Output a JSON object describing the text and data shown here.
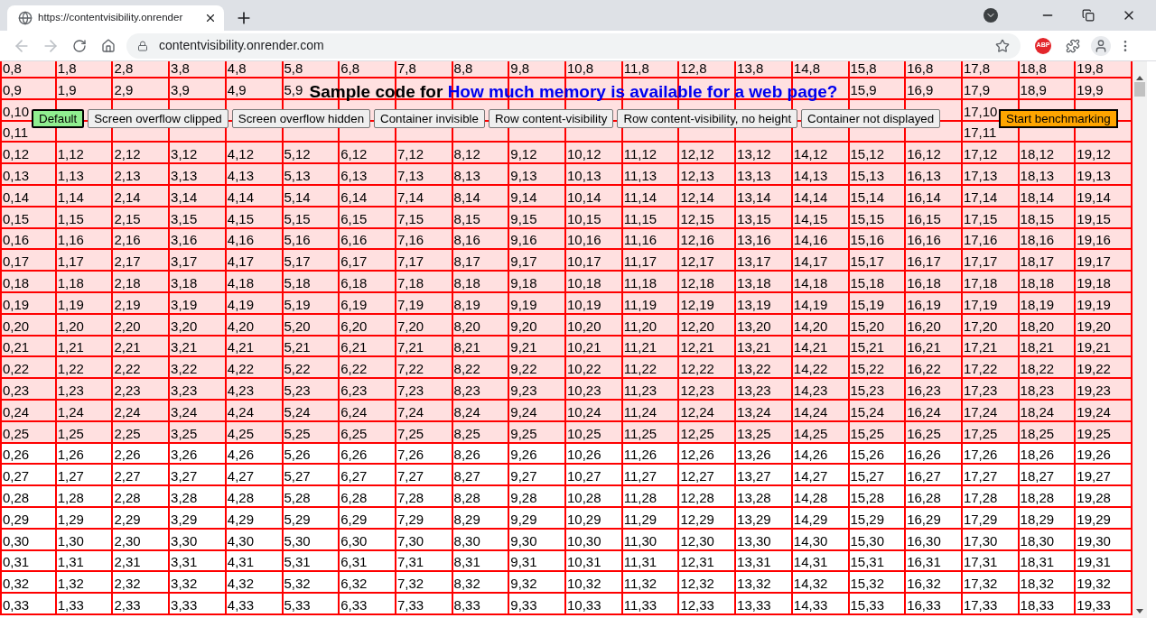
{
  "browser": {
    "tab_title": "https://contentvisibility.onrender",
    "address": "contentvisibility.onrender.com",
    "extension_badge": "ABP"
  },
  "page": {
    "heading": "Sample code for",
    "heading_link": "How much memory is available for a web page?",
    "buttons": [
      {
        "label": "Default",
        "selected": true
      },
      {
        "label": "Screen overflow clipped",
        "selected": false
      },
      {
        "label": "Screen overflow hidden",
        "selected": false
      },
      {
        "label": "Container invisible",
        "selected": false
      },
      {
        "label": "Row content-visibility",
        "selected": false
      },
      {
        "label": "Row content-visibility, no height",
        "selected": false
      },
      {
        "label": "Container not displayed",
        "selected": false
      }
    ],
    "benchmark_button": "Start benchmarking"
  },
  "table": {
    "rows": [
      {
        "shaded": true,
        "cells": [
          "0,8",
          "1,8",
          "2,8",
          "3,8",
          "4,8",
          "5,8",
          "6,8",
          "7,8",
          "8,8",
          "9,8",
          "10,8",
          "11,8",
          "12,8",
          "13,8",
          "14,8",
          "15,8",
          "16,8",
          "17,8",
          "18,8",
          "19,8"
        ]
      },
      {
        "shaded": true,
        "cells": [
          "0,9",
          "1,9",
          "2,9",
          "3,9",
          "4,9",
          "5,9",
          null,
          null,
          null,
          null,
          null,
          null,
          null,
          null,
          null,
          "15,9",
          "16,9",
          "17,9",
          "18,9",
          "19,9"
        ]
      },
      {
        "shaded": true,
        "cells": [
          "0,10",
          null,
          null,
          null,
          null,
          null,
          null,
          null,
          null,
          null,
          null,
          null,
          null,
          null,
          null,
          null,
          null,
          "17,10",
          null,
          null
        ]
      },
      {
        "shaded": true,
        "cells": [
          "0,11",
          null,
          null,
          null,
          null,
          null,
          null,
          null,
          null,
          null,
          null,
          null,
          null,
          null,
          null,
          null,
          null,
          "17,11",
          null,
          null
        ]
      },
      {
        "shaded": true,
        "cells": [
          "0,12",
          "1,12",
          "2,12",
          "3,12",
          "4,12",
          "5,12",
          "6,12",
          "7,12",
          "8,12",
          "9,12",
          "10,12",
          "11,12",
          "12,12",
          "13,12",
          "14,12",
          "15,12",
          "16,12",
          "17,12",
          "18,12",
          "19,12"
        ]
      },
      {
        "shaded": true,
        "cells": [
          "0,13",
          "1,13",
          "2,13",
          "3,13",
          "4,13",
          "5,13",
          "6,13",
          "7,13",
          "8,13",
          "9,13",
          "10,13",
          "11,13",
          "12,13",
          "13,13",
          "14,13",
          "15,13",
          "16,13",
          "17,13",
          "18,13",
          "19,13"
        ]
      },
      {
        "shaded": true,
        "cells": [
          "0,14",
          "1,14",
          "2,14",
          "3,14",
          "4,14",
          "5,14",
          "6,14",
          "7,14",
          "8,14",
          "9,14",
          "10,14",
          "11,14",
          "12,14",
          "13,14",
          "14,14",
          "15,14",
          "16,14",
          "17,14",
          "18,14",
          "19,14"
        ]
      },
      {
        "shaded": true,
        "cells": [
          "0,15",
          "1,15",
          "2,15",
          "3,15",
          "4,15",
          "5,15",
          "6,15",
          "7,15",
          "8,15",
          "9,15",
          "10,15",
          "11,15",
          "12,15",
          "13,15",
          "14,15",
          "15,15",
          "16,15",
          "17,15",
          "18,15",
          "19,15"
        ]
      },
      {
        "shaded": true,
        "cells": [
          "0,16",
          "1,16",
          "2,16",
          "3,16",
          "4,16",
          "5,16",
          "6,16",
          "7,16",
          "8,16",
          "9,16",
          "10,16",
          "11,16",
          "12,16",
          "13,16",
          "14,16",
          "15,16",
          "16,16",
          "17,16",
          "18,16",
          "19,16"
        ]
      },
      {
        "shaded": true,
        "cells": [
          "0,17",
          "1,17",
          "2,17",
          "3,17",
          "4,17",
          "5,17",
          "6,17",
          "7,17",
          "8,17",
          "9,17",
          "10,17",
          "11,17",
          "12,17",
          "13,17",
          "14,17",
          "15,17",
          "16,17",
          "17,17",
          "18,17",
          "19,17"
        ]
      },
      {
        "shaded": true,
        "cells": [
          "0,18",
          "1,18",
          "2,18",
          "3,18",
          "4,18",
          "5,18",
          "6,18",
          "7,18",
          "8,18",
          "9,18",
          "10,18",
          "11,18",
          "12,18",
          "13,18",
          "14,18",
          "15,18",
          "16,18",
          "17,18",
          "18,18",
          "19,18"
        ]
      },
      {
        "shaded": true,
        "cells": [
          "0,19",
          "1,19",
          "2,19",
          "3,19",
          "4,19",
          "5,19",
          "6,19",
          "7,19",
          "8,19",
          "9,19",
          "10,19",
          "11,19",
          "12,19",
          "13,19",
          "14,19",
          "15,19",
          "16,19",
          "17,19",
          "18,19",
          "19,19"
        ]
      },
      {
        "shaded": true,
        "cells": [
          "0,20",
          "1,20",
          "2,20",
          "3,20",
          "4,20",
          "5,20",
          "6,20",
          "7,20",
          "8,20",
          "9,20",
          "10,20",
          "11,20",
          "12,20",
          "13,20",
          "14,20",
          "15,20",
          "16,20",
          "17,20",
          "18,20",
          "19,20"
        ]
      },
      {
        "shaded": true,
        "cells": [
          "0,21",
          "1,21",
          "2,21",
          "3,21",
          "4,21",
          "5,21",
          "6,21",
          "7,21",
          "8,21",
          "9,21",
          "10,21",
          "11,21",
          "12,21",
          "13,21",
          "14,21",
          "15,21",
          "16,21",
          "17,21",
          "18,21",
          "19,21"
        ]
      },
      {
        "shaded": true,
        "cells": [
          "0,22",
          "1,22",
          "2,22",
          "3,22",
          "4,22",
          "5,22",
          "6,22",
          "7,22",
          "8,22",
          "9,22",
          "10,22",
          "11,22",
          "12,22",
          "13,22",
          "14,22",
          "15,22",
          "16,22",
          "17,22",
          "18,22",
          "19,22"
        ]
      },
      {
        "shaded": true,
        "cells": [
          "0,23",
          "1,23",
          "2,23",
          "3,23",
          "4,23",
          "5,23",
          "6,23",
          "7,23",
          "8,23",
          "9,23",
          "10,23",
          "11,23",
          "12,23",
          "13,23",
          "14,23",
          "15,23",
          "16,23",
          "17,23",
          "18,23",
          "19,23"
        ]
      },
      {
        "shaded": true,
        "cells": [
          "0,24",
          "1,24",
          "2,24",
          "3,24",
          "4,24",
          "5,24",
          "6,24",
          "7,24",
          "8,24",
          "9,24",
          "10,24",
          "11,24",
          "12,24",
          "13,24",
          "14,24",
          "15,24",
          "16,24",
          "17,24",
          "18,24",
          "19,24"
        ]
      },
      {
        "shaded": true,
        "cells": [
          "0,25",
          "1,25",
          "2,25",
          "3,25",
          "4,25",
          "5,25",
          "6,25",
          "7,25",
          "8,25",
          "9,25",
          "10,25",
          "11,25",
          "12,25",
          "13,25",
          "14,25",
          "15,25",
          "16,25",
          "17,25",
          "18,25",
          "19,25"
        ]
      },
      {
        "shaded": false,
        "cells": [
          "0,26",
          "1,26",
          "2,26",
          "3,26",
          "4,26",
          "5,26",
          "6,26",
          "7,26",
          "8,26",
          "9,26",
          "10,26",
          "11,26",
          "12,26",
          "13,26",
          "14,26",
          "15,26",
          "16,26",
          "17,26",
          "18,26",
          "19,26"
        ]
      },
      {
        "shaded": false,
        "cells": [
          "0,27",
          "1,27",
          "2,27",
          "3,27",
          "4,27",
          "5,27",
          "6,27",
          "7,27",
          "8,27",
          "9,27",
          "10,27",
          "11,27",
          "12,27",
          "13,27",
          "14,27",
          "15,27",
          "16,27",
          "17,27",
          "18,27",
          "19,27"
        ]
      },
      {
        "shaded": false,
        "cells": [
          "0,28",
          "1,28",
          "2,28",
          "3,28",
          "4,28",
          "5,28",
          "6,28",
          "7,28",
          "8,28",
          "9,28",
          "10,28",
          "11,28",
          "12,28",
          "13,28",
          "14,28",
          "15,28",
          "16,28",
          "17,28",
          "18,28",
          "19,28"
        ]
      },
      {
        "shaded": false,
        "cells": [
          "0,29",
          "1,29",
          "2,29",
          "3,29",
          "4,29",
          "5,29",
          "6,29",
          "7,29",
          "8,29",
          "9,29",
          "10,29",
          "11,29",
          "12,29",
          "13,29",
          "14,29",
          "15,29",
          "16,29",
          "17,29",
          "18,29",
          "19,29"
        ]
      },
      {
        "shaded": false,
        "cells": [
          "0,30",
          "1,30",
          "2,30",
          "3,30",
          "4,30",
          "5,30",
          "6,30",
          "7,30",
          "8,30",
          "9,30",
          "10,30",
          "11,30",
          "12,30",
          "13,30",
          "14,30",
          "15,30",
          "16,30",
          "17,30",
          "18,30",
          "19,30"
        ]
      },
      {
        "shaded": false,
        "cells": [
          "0,31",
          "1,31",
          "2,31",
          "3,31",
          "4,31",
          "5,31",
          "6,31",
          "7,31",
          "8,31",
          "9,31",
          "10,31",
          "11,31",
          "12,31",
          "13,31",
          "14,31",
          "15,31",
          "16,31",
          "17,31",
          "18,31",
          "19,31"
        ]
      },
      {
        "shaded": false,
        "cells": [
          "0,32",
          "1,32",
          "2,32",
          "3,32",
          "4,32",
          "5,32",
          "6,32",
          "7,32",
          "8,32",
          "9,32",
          "10,32",
          "11,32",
          "12,32",
          "13,32",
          "14,32",
          "15,32",
          "16,32",
          "17,32",
          "18,32",
          "19,32"
        ]
      },
      {
        "shaded": false,
        "cells": [
          "0,33",
          "1,33",
          "2,33",
          "3,33",
          "4,33",
          "5,33",
          "6,33",
          "7,33",
          "8,33",
          "9,33",
          "10,33",
          "11,33",
          "12,33",
          "13,33",
          "14,33",
          "15,33",
          "16,33",
          "17,33",
          "18,33",
          "19,33"
        ]
      }
    ]
  }
}
